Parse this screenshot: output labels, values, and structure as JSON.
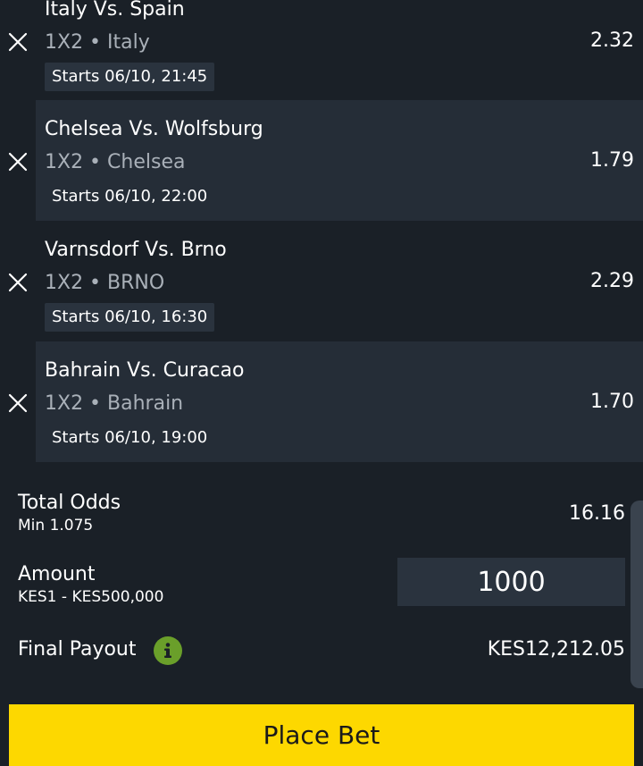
{
  "bets": [
    {
      "match": "Italy Vs. Spain",
      "selection": "1X2 • Italy",
      "starts": "Starts 06/10, 21:45",
      "odds": "2.32"
    },
    {
      "match": "Chelsea Vs. Wolfsburg",
      "selection": "1X2 • Chelsea",
      "starts": "Starts 06/10, 22:00",
      "odds": "1.79"
    },
    {
      "match": "Varnsdorf Vs. Brno",
      "selection": "1X2 • BRNO",
      "starts": "Starts 06/10, 16:30",
      "odds": "2.29"
    },
    {
      "match": "Bahrain Vs. Curacao",
      "selection": "1X2 • Bahrain",
      "starts": "Starts 06/10, 19:00",
      "odds": "1.70"
    }
  ],
  "summary": {
    "total_odds_label": "Total Odds",
    "min_odds": "Min 1.075",
    "total_odds": "16.16",
    "amount_label": "Amount",
    "amount_range": "KES1 - KES500,000",
    "amount_value": "1000",
    "payout_label": "Final Payout",
    "payout_value": "KES12,212.05"
  },
  "actions": {
    "place_bet_label": "Place Bet"
  },
  "icons": {
    "remove": "close-icon",
    "info": "info-icon"
  },
  "colors": {
    "background": "#1a2027",
    "card_alt": "#252d37",
    "accent_button": "#fdd800",
    "info_green": "#6a9f2a"
  }
}
